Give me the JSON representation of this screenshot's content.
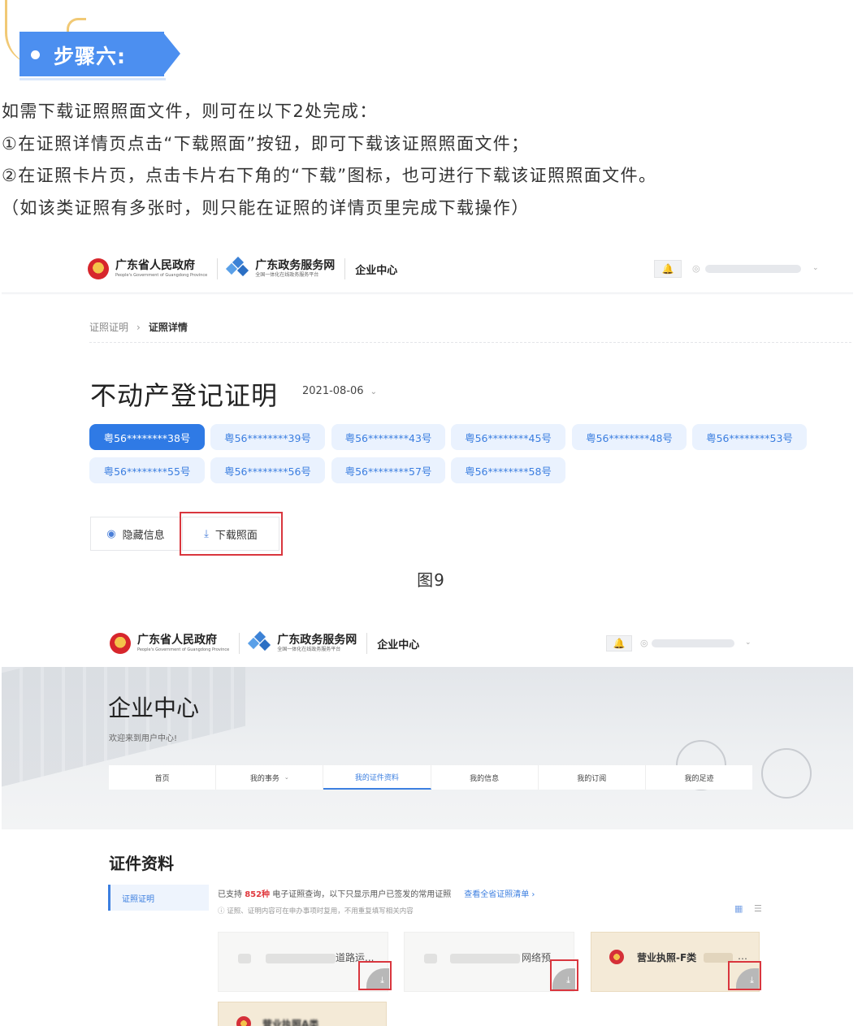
{
  "step": {
    "title": "步骤六:"
  },
  "intro": [
    "如需下载证照照面文件，则可在以下2处完成：",
    "①在证照详情页点击“下载照面”按钮，即可下载该证照照面文件；",
    "②在证照卡片页，点击卡片右下角的“下载”图标，也可进行下载该证照照面文件。",
    "（如该类证照有多张时，则只能在证照的详情页里完成下载操作）"
  ],
  "header": {
    "gov_title": "广东省人民政府",
    "gov_sub": "People's Government of Guangdong Province",
    "service_title": "广东政务服务网",
    "service_sub": "全国一体化在线政务服务平台",
    "center": "企业中心"
  },
  "detail": {
    "breadcrumb": [
      "证照证明",
      "证照详情"
    ],
    "title": "不动产登记证明",
    "date": "2021-08-06",
    "certs": [
      "粤56********38号",
      "粤56********39号",
      "粤56********43号",
      "粤56********45号",
      "粤56********48号",
      "粤56********53号",
      "粤56********55号",
      "粤56********56号",
      "粤56********57号",
      "粤56********58号"
    ],
    "hide_btn": "隐藏信息",
    "download_btn": "下载照面"
  },
  "caption": "图9",
  "center_page": {
    "title": "企业中心",
    "welcome": "欢迎来到用户中心!",
    "nav": [
      "首页",
      "我的事务",
      "我的证件资料",
      "我的信息",
      "我的订阅",
      "我的足迹"
    ],
    "section_title": "证件资料",
    "side_item": "证照证明",
    "info_prefix": "已支持",
    "info_count": "852种",
    "info_suffix": "电子证照查询，以下只显示用户已签发的常用证照",
    "info_link": "查看全省证照清单 ›",
    "info_note": "ⓘ 证照、证明内容可在申办事项时复用，不用重复填写相关内容",
    "cards": [
      "道路运...",
      "网络预...",
      "营业执照-F类",
      "营业执照A类"
    ]
  },
  "colors": {
    "accent": "#2f7ae5",
    "banner": "#4c8ff0",
    "highlight": "#d9363e"
  }
}
